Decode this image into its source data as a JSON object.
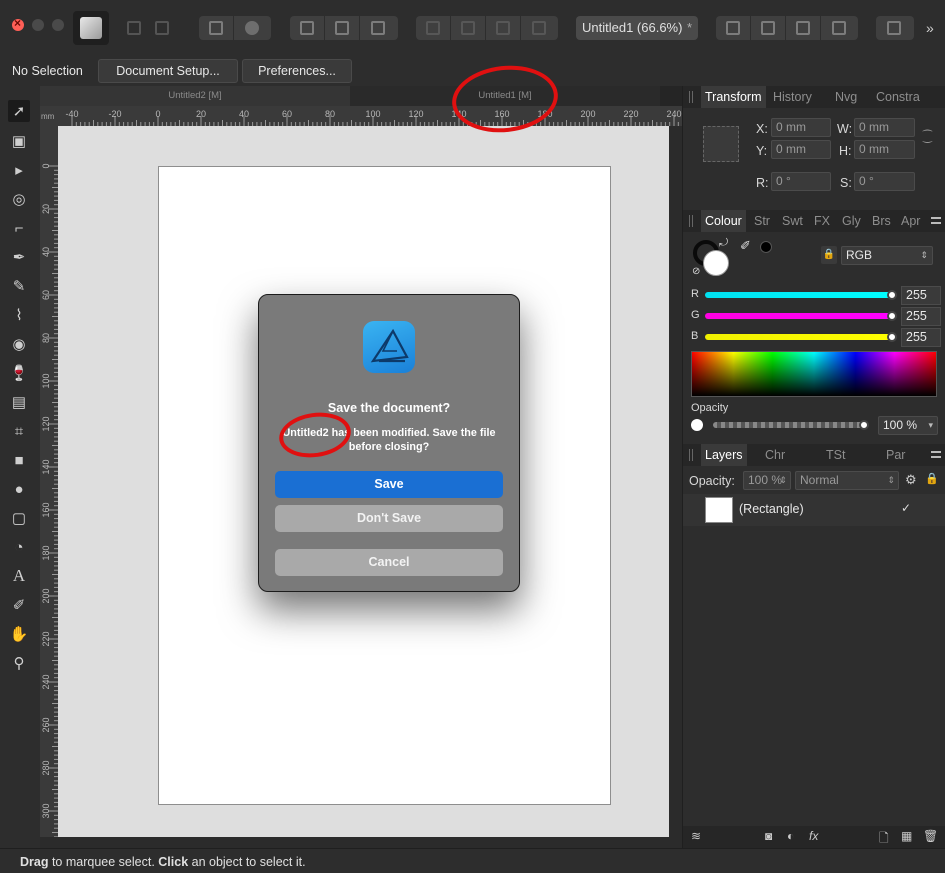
{
  "window": {
    "doc_title": "Untitled1 (66.6%)",
    "doc_title_close": "*"
  },
  "contextbar": {
    "selection_label": "No Selection",
    "document_setup_label": "Document Setup...",
    "preferences_label": "Preferences..."
  },
  "doc_tabs": [
    {
      "label": "Untitled2 [M]"
    },
    {
      "label": "Untitled1 [M]"
    }
  ],
  "ruler": {
    "unit": "mm",
    "h_ticks": [
      "-40",
      "-20",
      "0",
      "20",
      "40",
      "60",
      "80",
      "100",
      "120",
      "140",
      "160",
      "180",
      "200",
      "220",
      "240"
    ],
    "v_ticks": [
      "0",
      "20",
      "40",
      "60",
      "80",
      "100",
      "120",
      "140",
      "160",
      "180",
      "200",
      "220",
      "240",
      "260",
      "280",
      "300"
    ]
  },
  "dialog": {
    "title": "Save the document?",
    "message": "Untitled2 has been modified. Save the file before closing?",
    "save_label": "Save",
    "dont_save_label": "Don't Save",
    "cancel_label": "Cancel"
  },
  "transform_panel": {
    "tabs": [
      "Transform",
      "History",
      "Nvg",
      "Constra"
    ],
    "x_label": "X:",
    "x_value": "0 mm",
    "y_label": "Y:",
    "y_value": "0 mm",
    "w_label": "W:",
    "w_value": "0 mm",
    "h_label": "H:",
    "h_value": "0 mm",
    "r_label": "R:",
    "r_value": "0 °",
    "s_label": "S:",
    "s_value": "0 °"
  },
  "colour_panel": {
    "tabs": [
      "Colour",
      "Str",
      "Swt",
      "FX",
      "Gly",
      "Brs",
      "Apr"
    ],
    "mode": "RGB",
    "r_label": "R",
    "r_value": "255",
    "g_label": "G",
    "g_value": "255",
    "b_label": "B",
    "b_value": "255",
    "opacity_label": "Opacity",
    "opacity_value": "100 %"
  },
  "layers_panel": {
    "tabs": [
      "Layers",
      "Chr",
      "TSt",
      "Par"
    ],
    "opacity_label": "Opacity:",
    "opacity_value": "100 %",
    "blend_mode": "Normal",
    "layers": [
      {
        "name": "(Rectangle)",
        "visible_check": "✓"
      }
    ]
  },
  "status": {
    "drag": "Drag",
    "drag_rest": " to marquee select. ",
    "click": "Click",
    "click_rest": " an object to select it."
  },
  "colors": {
    "accent_blue": "#1a6fd3",
    "annotation_red": "#e01010",
    "slider_r": "#00e5f0",
    "slider_g": "#ff00ff",
    "slider_b": "#ffff00"
  }
}
